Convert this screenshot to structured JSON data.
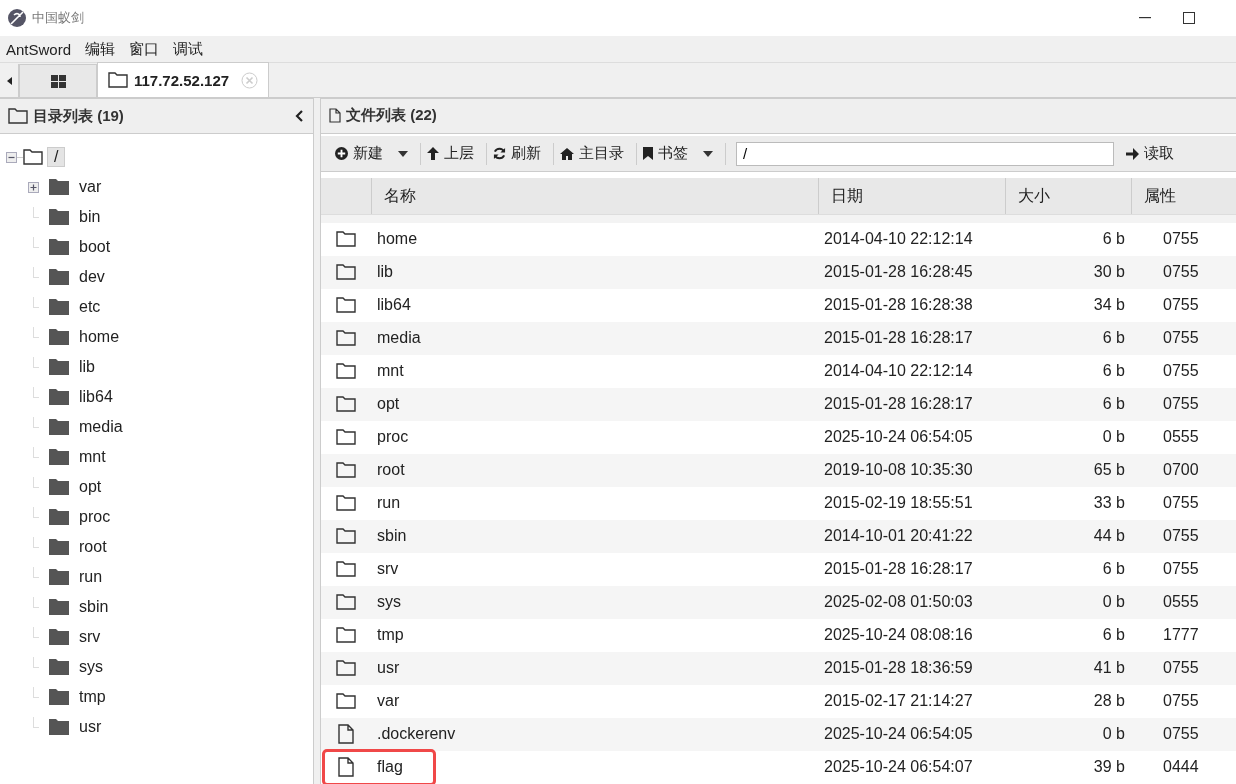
{
  "window": {
    "title": "中国蚁剑"
  },
  "menu": [
    "AntSword",
    "编辑",
    "窗口",
    "调试"
  ],
  "tabs": [
    {
      "kind": "home",
      "selected": false
    },
    {
      "kind": "site",
      "label": "117.72.52.127",
      "selected": true
    }
  ],
  "sidebar": {
    "title": "目录列表 (19)",
    "tree": [
      {
        "name": "/",
        "expanded": true,
        "selected": true,
        "children": [
          {
            "name": "var",
            "expandable": true
          },
          {
            "name": "bin",
            "expandable": false
          },
          {
            "name": "boot",
            "expandable": false
          },
          {
            "name": "dev",
            "expandable": false
          },
          {
            "name": "etc",
            "expandable": false
          },
          {
            "name": "home",
            "expandable": false
          },
          {
            "name": "lib",
            "expandable": false
          },
          {
            "name": "lib64",
            "expandable": false
          },
          {
            "name": "media",
            "expandable": false
          },
          {
            "name": "mnt",
            "expandable": false
          },
          {
            "name": "opt",
            "expandable": false
          },
          {
            "name": "proc",
            "expandable": false
          },
          {
            "name": "root",
            "expandable": false
          },
          {
            "name": "run",
            "expandable": false
          },
          {
            "name": "sbin",
            "expandable": false
          },
          {
            "name": "srv",
            "expandable": false
          },
          {
            "name": "sys",
            "expandable": false
          },
          {
            "name": "tmp",
            "expandable": false
          },
          {
            "name": "usr",
            "expandable": false
          }
        ]
      }
    ]
  },
  "files": {
    "title": "文件列表 (22)",
    "toolbar": [
      {
        "kind": "plus",
        "label": "新建",
        "dropdown": true
      },
      {
        "kind": "up",
        "label": "上层",
        "dropdown": false
      },
      {
        "kind": "refresh",
        "label": "刷新",
        "dropdown": false
      },
      {
        "kind": "home",
        "label": "主目录",
        "dropdown": false
      },
      {
        "kind": "bookmark",
        "label": "书签",
        "dropdown": true
      }
    ],
    "path": "/",
    "read_button": "读取",
    "columns": [
      "名称",
      "日期",
      "大小",
      "属性"
    ],
    "rows": [
      {
        "kind": "folder",
        "name": "home",
        "date": "2014-04-10 22:12:14",
        "size": "6 b",
        "attr": "0755",
        "highlighted": false
      },
      {
        "kind": "folder",
        "name": "lib",
        "date": "2015-01-28 16:28:45",
        "size": "30 b",
        "attr": "0755",
        "highlighted": false
      },
      {
        "kind": "folder",
        "name": "lib64",
        "date": "2015-01-28 16:28:38",
        "size": "34 b",
        "attr": "0755",
        "highlighted": false
      },
      {
        "kind": "folder",
        "name": "media",
        "date": "2015-01-28 16:28:17",
        "size": "6 b",
        "attr": "0755",
        "highlighted": false
      },
      {
        "kind": "folder",
        "name": "mnt",
        "date": "2014-04-10 22:12:14",
        "size": "6 b",
        "attr": "0755",
        "highlighted": false
      },
      {
        "kind": "folder",
        "name": "opt",
        "date": "2015-01-28 16:28:17",
        "size": "6 b",
        "attr": "0755",
        "highlighted": false
      },
      {
        "kind": "folder",
        "name": "proc",
        "date": "2025-10-24 06:54:05",
        "size": "0 b",
        "attr": "0555",
        "highlighted": false
      },
      {
        "kind": "folder",
        "name": "root",
        "date": "2019-10-08 10:35:30",
        "size": "65 b",
        "attr": "0700",
        "highlighted": false
      },
      {
        "kind": "folder",
        "name": "run",
        "date": "2015-02-19 18:55:51",
        "size": "33 b",
        "attr": "0755",
        "highlighted": false
      },
      {
        "kind": "folder",
        "name": "sbin",
        "date": "2014-10-01 20:41:22",
        "size": "44 b",
        "attr": "0755",
        "highlighted": false
      },
      {
        "kind": "folder",
        "name": "srv",
        "date": "2015-01-28 16:28:17",
        "size": "6 b",
        "attr": "0755",
        "highlighted": false
      },
      {
        "kind": "folder",
        "name": "sys",
        "date": "2025-02-08 01:50:03",
        "size": "0 b",
        "attr": "0555",
        "highlighted": false
      },
      {
        "kind": "folder",
        "name": "tmp",
        "date": "2025-10-24 08:08:16",
        "size": "6 b",
        "attr": "1777",
        "highlighted": false
      },
      {
        "kind": "folder",
        "name": "usr",
        "date": "2015-01-28 18:36:59",
        "size": "41 b",
        "attr": "0755",
        "highlighted": false
      },
      {
        "kind": "folder",
        "name": "var",
        "date": "2015-02-17 21:14:27",
        "size": "28 b",
        "attr": "0755",
        "highlighted": false
      },
      {
        "kind": "file",
        "name": ".dockerenv",
        "date": "2025-10-24 06:54:05",
        "size": "0 b",
        "attr": "0755",
        "highlighted": false
      },
      {
        "kind": "file",
        "name": "flag",
        "date": "2025-10-24 06:54:07",
        "size": "39 b",
        "attr": "0444",
        "highlighted": true
      }
    ]
  }
}
